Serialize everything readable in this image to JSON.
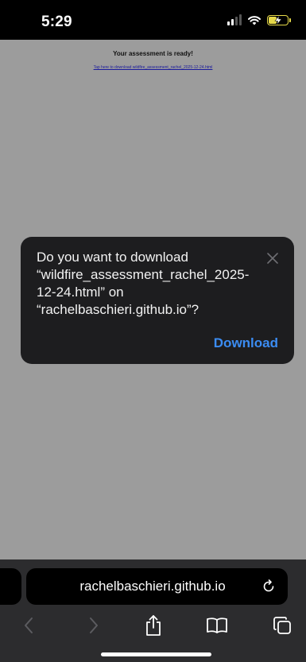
{
  "status_bar": {
    "time": "5:29",
    "icons": [
      "cellular-signal-icon",
      "wifi-icon",
      "battery-charging-icon"
    ],
    "battery_color": "#e6d94a"
  },
  "web_page": {
    "heading": "Your assessment is ready!",
    "link_text": "Tap here to download wildfire_assessment_rachel_2025-12-24.html"
  },
  "dialog": {
    "message": "Do you want to download “wildfire_assessment_rachel_2025-12-24.html” on “rachelbaschieri.github.io”?",
    "download_label": "Download",
    "accent_color": "#3b8cf2"
  },
  "browser": {
    "address": "rachelbaschieri.github.io",
    "nav_icons": [
      "back-icon",
      "forward-icon",
      "share-icon",
      "bookmarks-icon",
      "tabs-icon"
    ]
  }
}
